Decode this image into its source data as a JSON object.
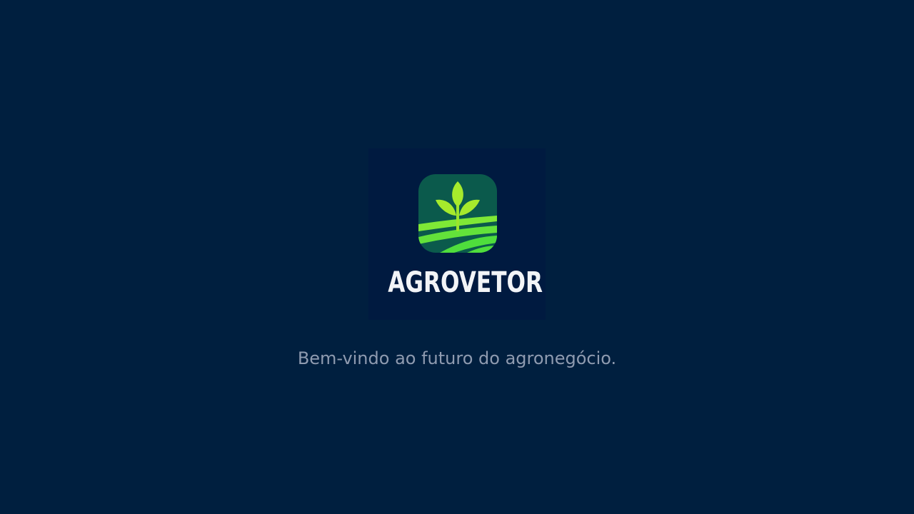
{
  "brand": {
    "name": "AGROVETOR",
    "colors": {
      "background": "#001f3f",
      "icon_background": "#0b5a4c",
      "leaf_green": "#9be52c",
      "stripe_green": "#55e83c"
    }
  },
  "splash": {
    "tagline": "Bem-vindo ao futuro do agronegócio."
  }
}
